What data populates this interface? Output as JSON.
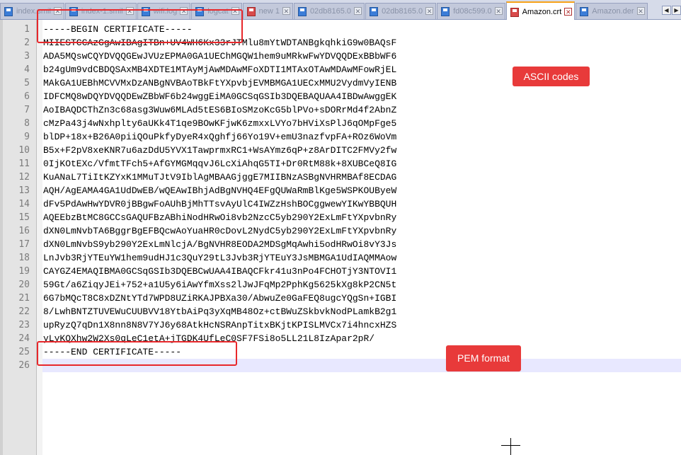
{
  "tabs": [
    {
      "label": "index.smil",
      "state": "saved"
    },
    {
      "label": "index-1.smil",
      "state": "saved"
    },
    {
      "label": "wifi.log",
      "state": "saved"
    },
    {
      "label": "logcat",
      "state": "saved"
    },
    {
      "label": "new 1",
      "state": "unsaved"
    },
    {
      "label": "02db8165.0",
      "state": "saved"
    },
    {
      "label": "02db8165.0",
      "state": "saved"
    },
    {
      "label": "fd08c599.0",
      "state": "saved"
    },
    {
      "label": "Amazon.crt",
      "state": "unsaved",
      "active": true
    },
    {
      "label": "Amazon.der",
      "state": "saved"
    }
  ],
  "tab_close_glyph": "✕",
  "scroll_buttons": {
    "left": "◀",
    "right": "▶"
  },
  "editor": {
    "line_numbers": [
      "1",
      "2",
      "3",
      "4",
      "5",
      "6",
      "7",
      "8",
      "9",
      "10",
      "11",
      "12",
      "13",
      "14",
      "15",
      "16",
      "17",
      "18",
      "19",
      "20",
      "21",
      "22",
      "23",
      "24",
      "25",
      "26"
    ],
    "lines": [
      "-----BEGIN CERTIFICATE-----",
      "MIIESTCCAzGgAwIBAgITBn+UV4WH6Kx33rJTMlu8mYtWDTANBgkqhkiG9w0BAQsF",
      "ADA5MQswCQYDVQQGEwJVUzEPMA0GA1UEChMGQW1hem9uMRkwFwYDVQQDExBBbWF6",
      "b24gUm9vdCBDQSAxMB4XDTE1MTAyMjAwMDAwMFoXDTI1MTAxOTAwMDAwMFowRjEL",
      "MAkGA1UEBhMCVVMxDzANBgNVBAoTBkFtYXpvbjEVMBMGA1UECxMMU2VydmVyIENB",
      "IDFCMQ8wDQYDVQQDEwZBbWF6b24wggEiMA0GCSqGSIb3DQEBAQUAA4IBDwAwggEK",
      "AoIBAQDCThZn3c68asg3Wuw6MLAd5tES6BIoSMzoKcG5blPVo+sDORrMd4f2AbnZ",
      "cMzPa43j4wNxhplty6aUKk4T1qe9BOwKFjwK6zmxxLVYo7bHViXsPlJ6qOMpFge5",
      "blDP+18x+B26A0piiQOuPkfyDyeR4xQghfj66Yo19V+emU3nazfvpFA+ROz6WoVm",
      "B5x+F2pV8xeKNR7u6azDdU5YVX1TawprmxRC1+WsAYmz6qP+z8ArDITC2FMVy2fw",
      "0IjKOtEXc/VfmtTFch5+AfGYMGMqqvJ6LcXiAhqG5TI+Dr0RtM88k+8XUBCeQ8IG",
      "KuANaL7TiItKZYxK1MMuTJtV9IblAgMBAAGjggE7MIIBNzASBgNVHRMBAf8ECDAG",
      "AQH/AgEAMA4GA1UdDwEB/wQEAwIBhjAdBgNVHQ4EFgQUWaRmBlKge5WSPKOUByeW",
      "dFv5PdAwHwYDVR0jBBgwFoAUhBjMhTTsvAyUlC4IWZzHshBOCggwewYIKwYBBQUH",
      "AQEEbzBtMC8GCCsGAQUFBzABhiNodHRwOi8vb2NzcC5yb290Y2ExLmFtYXpvbnRy",
      "dXN0LmNvbTA6BggrBgEFBQcwAoYuaHR0cDovL2NydC5yb290Y2ExLmFtYXpvbnRy",
      "dXN0LmNvbS9yb290Y2ExLmNlcjA/BgNVHR8EODA2MDSgMqAwhi5odHRwOi8vY3Js",
      "LnJvb3RjYTEuYW1hem9udHJ1c3QuY29tL3Jvb3RjYTEuY3JsMBMGA1UdIAQMMAow",
      "CAYGZ4EMAQIBMA0GCSqGSIb3DQEBCwUAA4IBAQCFkr41u3nPo4FCHOTjY3NTOVI1",
      "59Gt/a6ZiqyJEi+752+a1U5y6iAwYfmXss2lJwJFqMp2PphKg5625kXg8kP2CN5t",
      "6G7bMQcT8C8xDZNtYTd7WPD8UZiRKAJPBXa30/AbwuZe0GaFEQ8ugcYQgSn+IGBI",
      "8/LwhBNTZTUVEWuCUUBVV18YtbAiPq3yXqMB48Oz+ctBWuZSkbvkNodPLamkB2g1",
      "upRyzQ7qDn1X8nn8N8V7YJ6y68AtkHcNSRAnpTitxBKjtKPISLMVCx7i4hncxHZS",
      "yLyKQXhw2W2Xs0qLeC1etA+jTGDK4UfLeC0SF7FSi8o5LL21L8IzApar2pR/",
      "-----END CERTIFICATE-----",
      ""
    ]
  },
  "callouts": {
    "ascii": "ASCII codes",
    "pem": "PEM format"
  },
  "colors": {
    "annotation_red": "#e8282b",
    "active_tab_accent": "#f7a21a"
  }
}
